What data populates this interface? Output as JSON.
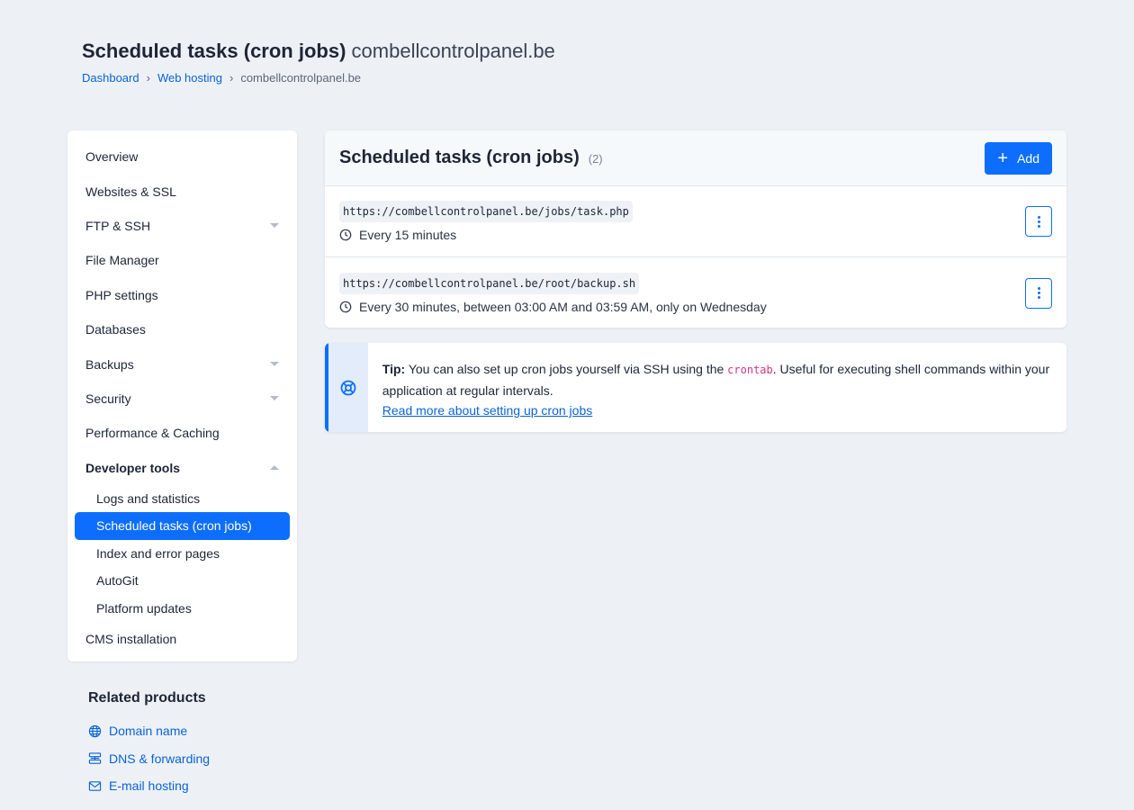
{
  "header": {
    "title": "Scheduled tasks (cron jobs)",
    "domain": "combellcontrolpanel.be",
    "breadcrumb": [
      "Dashboard",
      "Web hosting",
      "combellcontrolpanel.be"
    ],
    "separator": "›"
  },
  "sidebar": {
    "items": [
      {
        "label": "Overview"
      },
      {
        "label": "Websites & SSL"
      },
      {
        "label": "FTP & SSH"
      },
      {
        "label": "File Manager"
      },
      {
        "label": "PHP settings"
      },
      {
        "label": "Databases"
      },
      {
        "label": "Backups"
      },
      {
        "label": "Security"
      },
      {
        "label": "Performance & Caching"
      },
      {
        "label": "Developer tools"
      },
      {
        "label": "CMS installation"
      }
    ],
    "developer_tools_sub": [
      {
        "label": "Logs and statistics"
      },
      {
        "label": "Scheduled tasks (cron jobs)"
      },
      {
        "label": "Index and error pages"
      },
      {
        "label": "AutoGit"
      },
      {
        "label": "Platform updates"
      }
    ]
  },
  "related": {
    "title": "Related products",
    "links": [
      {
        "label": "Domain name",
        "icon": "globe-icon"
      },
      {
        "label": "DNS & forwarding",
        "icon": "dns-server-icon"
      },
      {
        "label": "E-mail hosting",
        "icon": "envelope-icon"
      }
    ]
  },
  "card": {
    "title": "Scheduled tasks (cron jobs)",
    "count": "(2)",
    "add_label": "Add",
    "jobs": [
      {
        "command": "https://combellcontrolpanel.be/jobs/task.php",
        "schedule": "Every 15 minutes"
      },
      {
        "command": "https://combellcontrolpanel.be/root/backup.sh",
        "schedule": "Every 30 minutes, between 03:00 AM and 03:59 AM, only on Wednesday"
      }
    ]
  },
  "tip": {
    "label": "Tip:",
    "text_before": "You can also set up cron jobs yourself via SSH using the",
    "code": "crontab",
    "text_after": ". Useful for executing shell commands within your application at regular intervals.",
    "link": "Read more about setting up cron jobs"
  },
  "colors": {
    "accent": "#0d6efd",
    "link": "#0a63d6",
    "background": "#edf1f6",
    "code_pink": "#d63384"
  }
}
